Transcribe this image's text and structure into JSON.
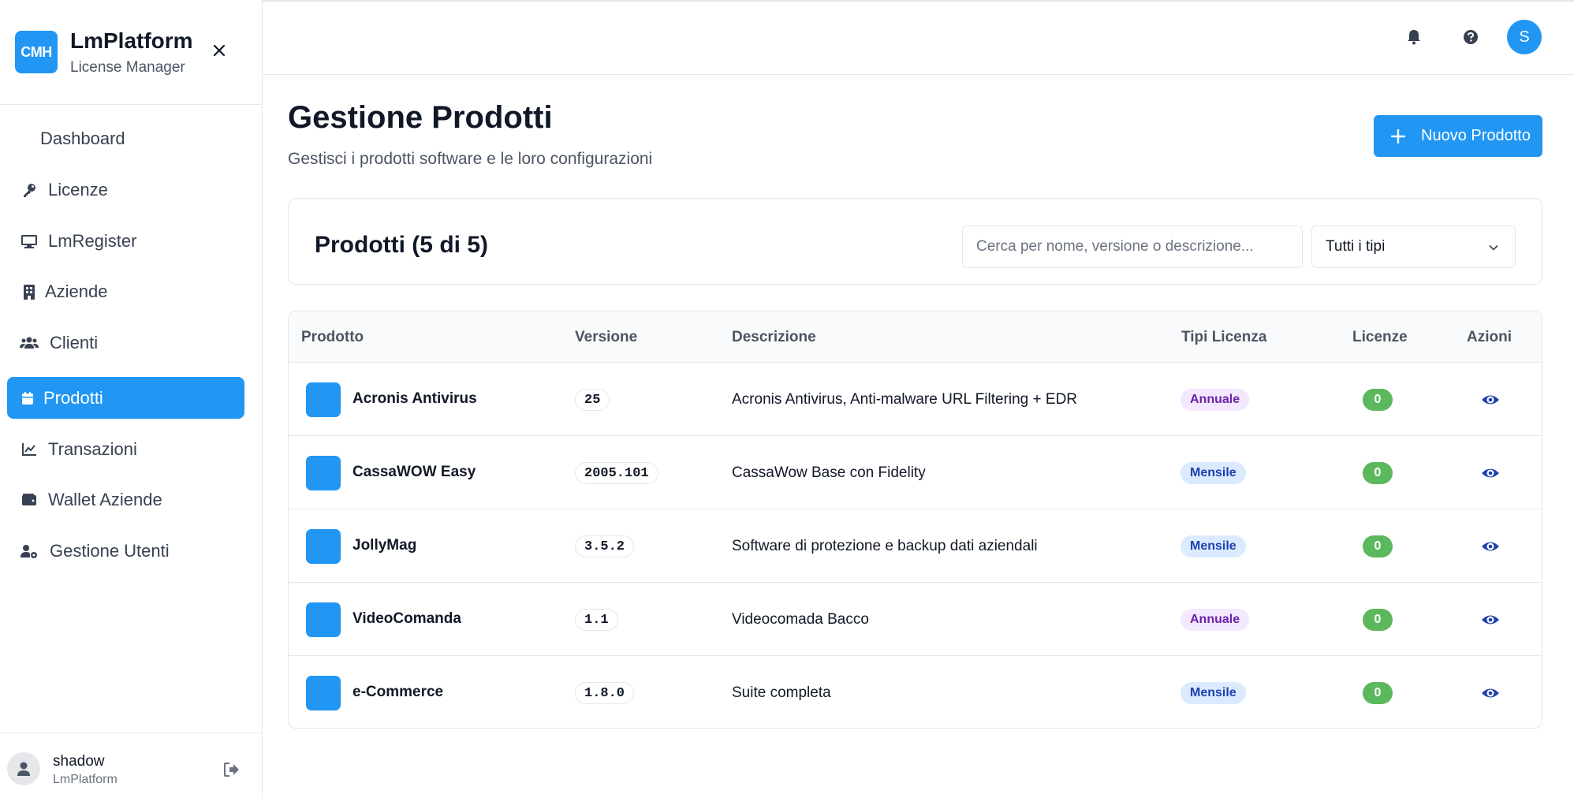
{
  "brand": {
    "logo_text": "CMH",
    "title": "LmPlatform",
    "subtitle": "License Manager"
  },
  "nav": {
    "items": [
      {
        "label": "Dashboard",
        "icon": "dashboard-icon"
      },
      {
        "label": "Licenze",
        "icon": "key-icon"
      },
      {
        "label": "LmRegister",
        "icon": "monitor-icon"
      },
      {
        "label": "Aziende",
        "icon": "building-icon"
      },
      {
        "label": "Clienti",
        "icon": "users-icon"
      },
      {
        "label": "Prodotti",
        "icon": "box-icon",
        "active": true
      },
      {
        "label": "Transazioni",
        "icon": "chart-line-icon"
      },
      {
        "label": "Wallet Aziende",
        "icon": "wallet-icon"
      },
      {
        "label": "Gestione Utenti",
        "icon": "user-cog-icon"
      }
    ]
  },
  "user": {
    "name": "shadow",
    "org": "LmPlatform"
  },
  "topbar": {
    "avatar_initial": "S"
  },
  "page": {
    "title": "Gestione Prodotti",
    "subtitle": "Gestisci i prodotti software e le loro configurazioni",
    "new_button_label": "Nuovo Prodotto"
  },
  "filters": {
    "title": "Prodotti (5 di 5)",
    "search_placeholder": "Cerca per nome, versione o descrizione...",
    "type_selected": "Tutti i tipi"
  },
  "table": {
    "headers": {
      "product": "Prodotto",
      "version": "Versione",
      "description": "Descrizione",
      "license_types": "Tipi Licenza",
      "licenses": "Licenze",
      "actions": "Azioni"
    },
    "rows": [
      {
        "name": "Acronis Antivirus",
        "version": "25",
        "description": "Acronis Antivirus, Anti-malware URL Filtering + EDR",
        "license_type": "Annuale",
        "licenses": "0"
      },
      {
        "name": "CassaWOW Easy",
        "version": "2005.101",
        "description": "CassaWow Base con Fidelity",
        "license_type": "Mensile",
        "licenses": "0"
      },
      {
        "name": "JollyMag",
        "version": "3.5.2",
        "description": "Software di protezione e backup dati aziendali",
        "license_type": "Mensile",
        "licenses": "0"
      },
      {
        "name": "VideoComanda",
        "version": "1.1",
        "description": "Videocomada Bacco",
        "license_type": "Annuale",
        "licenses": "0"
      },
      {
        "name": "e-Commerce",
        "version": "1.8.0",
        "description": "Suite completa",
        "license_type": "Mensile",
        "licenses": "0"
      }
    ]
  },
  "colors": {
    "accent": "#2196f3",
    "success": "#5cb85c",
    "annuale_bg": "#f3e8ff",
    "annuale_text": "#6b21a8",
    "mensile_bg": "#dbeafe",
    "mensile_text": "#1e40af"
  }
}
